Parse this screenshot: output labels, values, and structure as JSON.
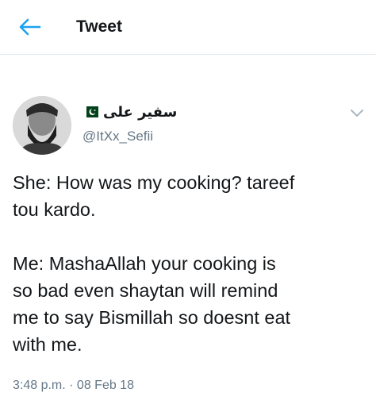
{
  "header": {
    "title": "Tweet",
    "back_icon": "arrow-left-icon",
    "accent_color": "#1da1f2"
  },
  "tweet": {
    "author": {
      "display_name": "سفیر علی",
      "flag_icon": "pakistan-flag-icon",
      "handle": "@ItXx_Sefii",
      "avatar_icon": "user-avatar"
    },
    "menu_icon": "chevron-down-icon",
    "text": "She: How was my cooking? tareef\ntou kardo.\n\nMe: MashaAllah your cooking is\nso bad even shaytan will remind\nme to say Bismillah so doesnt eat\nwith me.",
    "timestamp": "3:48 p.m. · 08 Feb 18"
  },
  "colors": {
    "text_primary": "#14171a",
    "text_secondary": "#657786",
    "divider": "#e1e8ed"
  }
}
